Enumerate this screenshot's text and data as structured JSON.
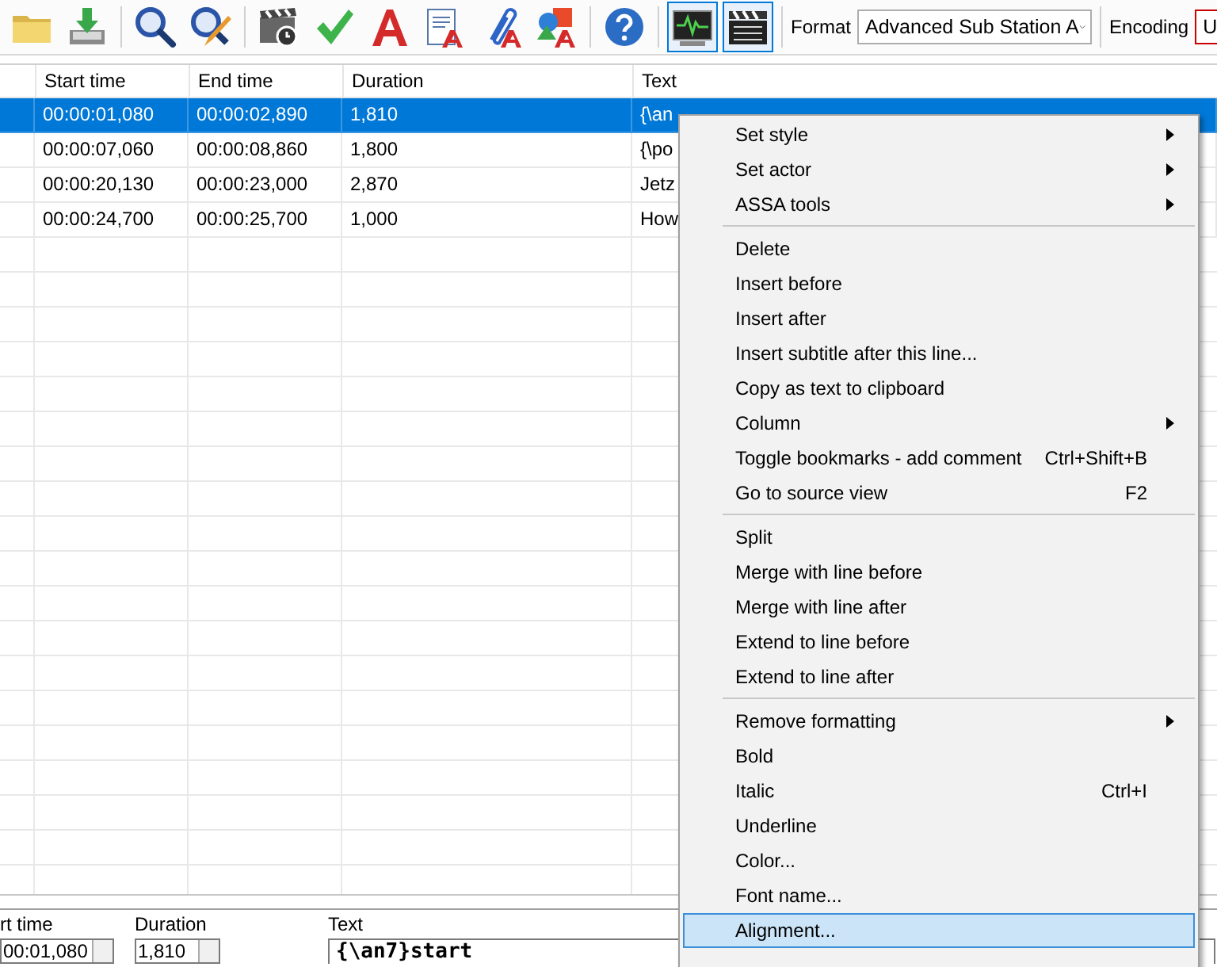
{
  "toolbar": {
    "groups": [
      [
        {
          "kind": "folder",
          "selected": false
        },
        {
          "kind": "download",
          "selected": false
        }
      ],
      [
        {
          "kind": "magnifier",
          "selected": false
        },
        {
          "kind": "magnifier-pencil",
          "selected": false
        }
      ],
      [
        {
          "kind": "film-clock",
          "selected": false
        },
        {
          "kind": "check",
          "selected": false
        },
        {
          "kind": "letter",
          "selected": false
        },
        {
          "kind": "doc-letter",
          "selected": false
        },
        {
          "kind": "clip-letter",
          "selected": false
        },
        {
          "kind": "shapes-letter",
          "selected": false
        }
      ],
      [
        {
          "kind": "help",
          "selected": false
        }
      ],
      [
        {
          "kind": "waveform",
          "selected": true
        },
        {
          "kind": "clapper",
          "selected": true
        }
      ]
    ],
    "format": {
      "label": "Format",
      "value": "Advanced Sub Station A"
    },
    "encoding": {
      "label": "Encoding",
      "value": "U"
    }
  },
  "table": {
    "columns": [
      "Start time",
      "End time",
      "Duration",
      "Text"
    ],
    "rows": [
      {
        "selected": true,
        "cells": [
          "00:00:01,080",
          "00:00:02,890",
          "1,810",
          "{\\an"
        ]
      },
      {
        "selected": false,
        "cells": [
          "00:00:07,060",
          "00:00:08,860",
          "1,800",
          "{\\po"
        ]
      },
      {
        "selected": false,
        "cells": [
          "00:00:20,130",
          "00:00:23,000",
          "2,870",
          "Jetz"
        ]
      },
      {
        "selected": false,
        "cells": [
          "00:00:24,700",
          "00:00:25,700",
          "1,000",
          "How"
        ]
      }
    ]
  },
  "context_menu": {
    "items": [
      {
        "kind": "item",
        "label": "Set style",
        "submenu": true,
        "selected": false
      },
      {
        "kind": "item",
        "label": "Set actor",
        "submenu": true,
        "selected": false
      },
      {
        "kind": "item",
        "label": "ASSA tools",
        "submenu": true,
        "selected": false
      },
      {
        "kind": "separator"
      },
      {
        "kind": "item",
        "label": "Delete",
        "submenu": false,
        "selected": false
      },
      {
        "kind": "item",
        "label": "Insert before",
        "submenu": false,
        "selected": false
      },
      {
        "kind": "item",
        "label": "Insert after",
        "submenu": false,
        "selected": false
      },
      {
        "kind": "item",
        "label": "Insert subtitle after this line...",
        "submenu": false,
        "selected": false
      },
      {
        "kind": "item",
        "label": "Copy as text to clipboard",
        "submenu": false,
        "selected": false
      },
      {
        "kind": "item",
        "label": "Column",
        "submenu": true,
        "selected": false
      },
      {
        "kind": "item",
        "label": "Toggle bookmarks - add comment",
        "shortcut": "Ctrl+Shift+B",
        "submenu": false,
        "selected": false
      },
      {
        "kind": "item",
        "label": "Go to source view",
        "shortcut": "F2",
        "submenu": false,
        "selected": false
      },
      {
        "kind": "separator"
      },
      {
        "kind": "item",
        "label": "Split",
        "submenu": false,
        "selected": false
      },
      {
        "kind": "item",
        "label": "Merge with line before",
        "submenu": false,
        "selected": false
      },
      {
        "kind": "item",
        "label": "Merge with line after",
        "submenu": false,
        "selected": false
      },
      {
        "kind": "item",
        "label": "Extend to line before",
        "submenu": false,
        "selected": false
      },
      {
        "kind": "item",
        "label": "Extend to line after",
        "submenu": false,
        "selected": false
      },
      {
        "kind": "separator"
      },
      {
        "kind": "item",
        "label": "Remove formatting",
        "submenu": true,
        "selected": false
      },
      {
        "kind": "item",
        "label": "Bold",
        "submenu": false,
        "selected": false
      },
      {
        "kind": "item",
        "label": "Italic",
        "shortcut": "Ctrl+I",
        "submenu": false,
        "selected": false
      },
      {
        "kind": "item",
        "label": "Underline",
        "submenu": false,
        "selected": false
      },
      {
        "kind": "item",
        "label": "Color...",
        "submenu": false,
        "selected": false
      },
      {
        "kind": "item",
        "label": "Font name...",
        "submenu": false,
        "selected": false
      },
      {
        "kind": "item",
        "label": "Alignment...",
        "submenu": false,
        "selected": true
      }
    ]
  },
  "edit_panel": {
    "start": {
      "label": "rt time",
      "value": "00:01,080"
    },
    "duration": {
      "label": "Duration",
      "value": "1,810"
    },
    "text": {
      "label": "Text",
      "value": "{\\an7}start"
    }
  }
}
